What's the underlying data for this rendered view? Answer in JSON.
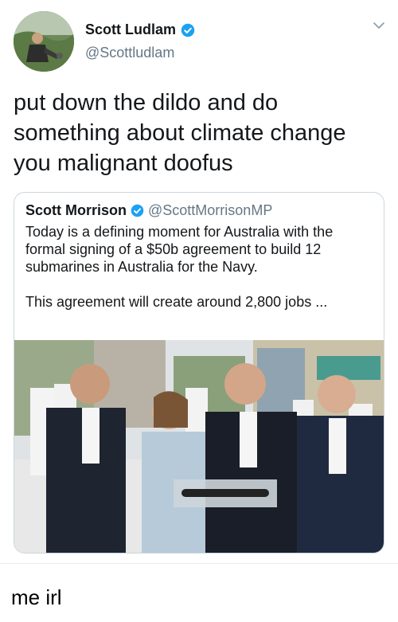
{
  "tweet": {
    "author_name": "Scott Ludlam",
    "author_handle": "@Scottludlam",
    "verified_icon": "verified-badge-icon",
    "menu_icon": "chevron-down-icon",
    "text_lines": [
      "put down the dildo and do",
      "something about climate change",
      "you malignant doofus"
    ]
  },
  "quoted_tweet": {
    "author_name": "Scott Morrison",
    "author_handle": "@ScottMorrisonMP",
    "paragraphs": [
      "Today is a defining moment for Australia with the formal signing of a $50b agreement to build 12 submarines in Australia for the Navy.",
      "This agreement will create around 2,800 jobs ..."
    ]
  },
  "caption": "me irl",
  "colors": {
    "verified": "#1da1f2",
    "handle": "#657786",
    "border": "#ccd6dd"
  }
}
